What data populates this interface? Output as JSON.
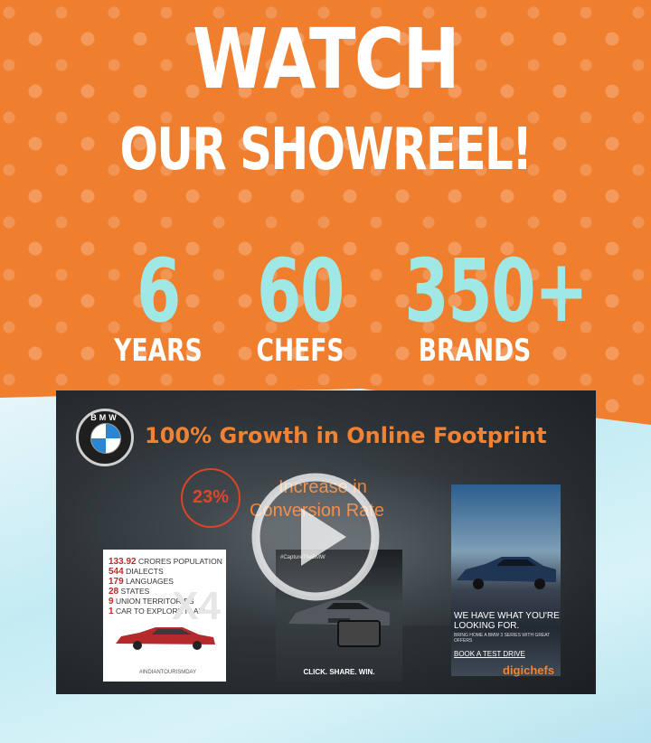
{
  "hero": {
    "title_line1": "WATCH",
    "title_line2": "OUR SHOWREEL!",
    "stats": [
      {
        "value": "6",
        "label": "YEARS"
      },
      {
        "value": "60",
        "label": "CHEFS"
      },
      {
        "value": "350+",
        "label": "BRANDS"
      }
    ]
  },
  "video": {
    "brand": "BMW",
    "headline": "100% Growth in Online Footprint",
    "increase_pct": "23%",
    "increase_line1": "Increase in",
    "increase_line2": "Conversion Rate",
    "card1": {
      "facts": [
        {
          "num": "133.92",
          "text": "CRORES POPULATION"
        },
        {
          "num": "544",
          "text": "DIALECTS"
        },
        {
          "num": "179",
          "text": "LANGUAGES"
        },
        {
          "num": "28",
          "text": "STATES"
        },
        {
          "num": "9",
          "text": "UNION TERRITORIES"
        },
        {
          "num": "1",
          "text": "CAR TO EXPLORE IT ALL"
        }
      ],
      "model": "X4",
      "hashtag": "#INDIANTOURISMDAY"
    },
    "card2": {
      "hashtag": "#CaptureTheBMW",
      "caption": "CLICK. SHARE. WIN."
    },
    "card3": {
      "headline": "WE HAVE WHAT YOU'RE LOOKING FOR.",
      "sub": "BRING HOME A BMW 3 SERIES WITH GREAT OFFERS",
      "cta": "BOOK A TEST DRIVE"
    },
    "agency": "digichefs",
    "play_icon": "play-icon"
  },
  "colors": {
    "orange": "#ef7e2e",
    "accent_teal": "#9fe8e6",
    "headline_orange": "#f08234"
  }
}
